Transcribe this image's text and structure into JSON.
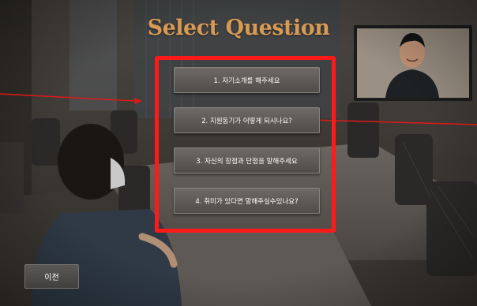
{
  "title": "Select Question",
  "questions": [
    {
      "label": "1. 자기소개를 해주세요"
    },
    {
      "label": "2. 지원동기가 어떻게 되시나요?"
    },
    {
      "label": "3. 자신의 장점과 단점을 말해주세요"
    },
    {
      "label": "4. 취미가 있다면 말해주실수있나요?"
    }
  ],
  "prev_button": {
    "label": "이전"
  },
  "colors": {
    "title": "#d69a55",
    "highlight": "#ff1a1a",
    "arrow": "#e01818"
  }
}
